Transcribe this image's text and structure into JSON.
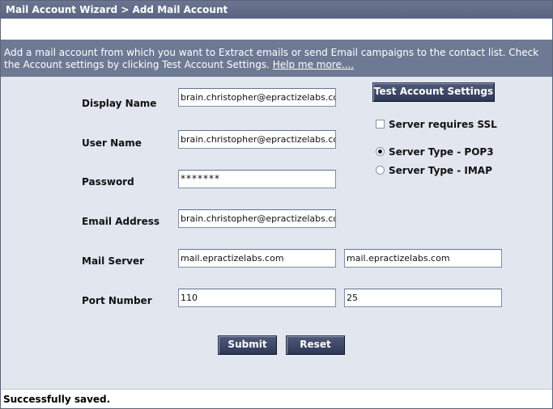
{
  "breadcrumb": "Mail Account Wizard > Add Mail Account",
  "info": {
    "text": "Add a mail account from which you want to Extract emails or send Email campaigns to the contact list. Check the Account settings by clicking Test Account Settings. ",
    "help_link": "Help me more...."
  },
  "form": {
    "display_name": {
      "label": "Display Name",
      "value": "brain.christopher@epractizelabs.com"
    },
    "user_name": {
      "label": "User Name",
      "value": "brain.christopher@epractizelabs.com"
    },
    "password": {
      "label": "Password",
      "value": "*******"
    },
    "email_address": {
      "label": "Email Address",
      "value": "brain.christopher@epractizelabs.com"
    },
    "mail_server": {
      "label": "Mail Server",
      "incoming": "mail.epractizelabs.com",
      "outgoing": "mail.epractizelabs.com"
    },
    "port_number": {
      "label": "Port Number",
      "incoming": "110",
      "outgoing": "25"
    }
  },
  "options": {
    "test_button": "Test Account Settings",
    "ssl_label": "Server requires SSL",
    "ssl_checked": false,
    "pop3_label": "Server Type - POP3",
    "imap_label": "Server Type - IMAP",
    "selected_server_type": "POP3"
  },
  "buttons": {
    "submit": "Submit",
    "reset": "Reset"
  },
  "status": "Successfully saved."
}
